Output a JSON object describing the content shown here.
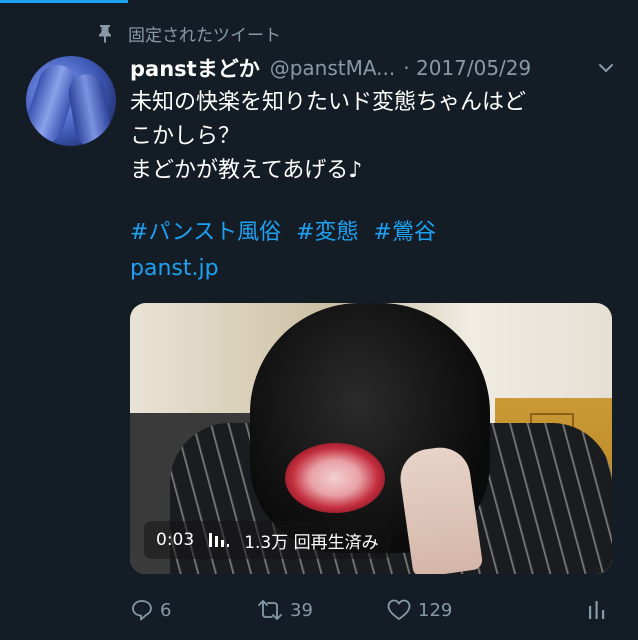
{
  "pinned": {
    "label": "固定されたツイート"
  },
  "tweet": {
    "display_name": "panstまどか",
    "handle": "@panstMA...",
    "date": "· 2017/05/29",
    "text_lines": [
      "未知の快楽を知りたいド変態ちゃんはど",
      "こかしら？",
      "まどかが教えてあげる♪"
    ],
    "hashtags": [
      "#パンスト風俗",
      "#変態",
      "#鶯谷"
    ],
    "link": "panst.jp"
  },
  "video": {
    "time": "0:03",
    "views": "1.3万 回再生済み"
  },
  "actions": {
    "replies": "6",
    "retweets": "39",
    "likes": "129"
  },
  "colors": {
    "background": "#141d26",
    "accent": "#1da1f2",
    "muted": "#8899a6"
  },
  "icons": [
    "pin-icon",
    "chevron-down-icon",
    "video-stats-icon",
    "reply-icon",
    "retweet-icon",
    "like-icon",
    "analytics-icon"
  ]
}
